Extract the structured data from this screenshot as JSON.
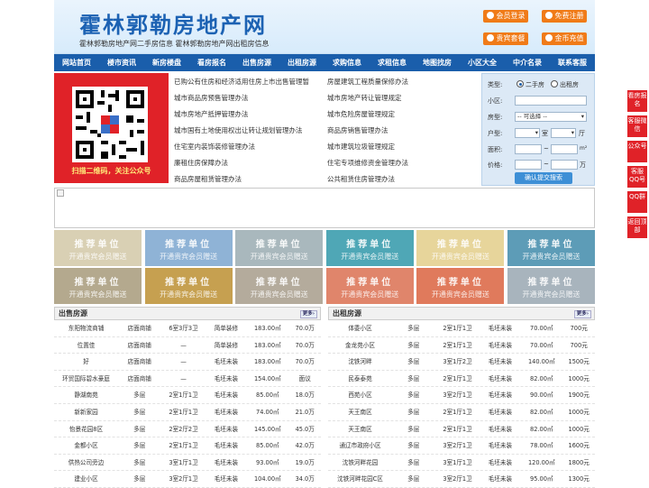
{
  "header": {
    "logo": "霍林郭勒房地产网",
    "slogan": "霍林郭勒房地产网二手房信息 霍林郭勒房地产网出租房信息",
    "buttons": [
      "会员登录",
      "免费注册",
      "贵宾套餐",
      "金币充值"
    ]
  },
  "nav": [
    "网站首页",
    "楼市资讯",
    "新房楼盘",
    "看房报名",
    "出售房源",
    "出租房源",
    "求购信息",
    "求租信息",
    "地图找房",
    "小区大全",
    "中介名录",
    "联系客服"
  ],
  "qr": {
    "caption": "扫描二维码，关注公众号"
  },
  "links": [
    "已购公有住房和经济适用住房上市出售管理暂",
    "房屋建筑工程质量保修办法",
    "城市商品房预售管理办法",
    "城市房地产转让管理规定",
    "城市房地产抵押管理办法",
    "城市危险房屋管理规定",
    "城市国有土地使用权出让转让规划管理办法",
    "商品房销售管理办法",
    "住宅室内装饰装修管理办法",
    "城市建筑垃圾管理规定",
    "廉租住房保障办法",
    "住宅专项维修资金管理办法",
    "商品房屋租赁管理办法",
    "公共租赁住房管理办法"
  ],
  "search": {
    "type_label": "类型:",
    "opt_sale": "二手房",
    "opt_rent": "出租房",
    "xiaoqu_label": "小区:",
    "fangxing_label": "房型:",
    "fangxing_value": "-- 可选择 --",
    "huxing_label": "户型:",
    "shi": "室",
    "ting": "厅",
    "area_label": "面积:",
    "price_label": "价格:",
    "tilde": "~",
    "sqm": "m²",
    "wan": "万",
    "submit": "确认提交搜索"
  },
  "ads": {
    "t1": "推荐单位",
    "t2": "开通贵宾会员赠送",
    "colors": [
      "#d9d0b4",
      "#8fb3d6",
      "#a9b8bd",
      "#4fa7b6",
      "#e7d59b",
      "#5d9cb7",
      "#b4a98e",
      "#c6a050",
      "#b4ab9c",
      "#e0856b",
      "#e07a5c",
      "#a8b4bd"
    ]
  },
  "sale": {
    "title": "出售房源",
    "more": "更多›",
    "rows": [
      [
        "东阳物流商铺",
        "店面商铺",
        "6室3厅3卫",
        "简单装修",
        "183.00㎡",
        "70.0万"
      ],
      [
        "位置佳",
        "店面商铺",
        "—",
        "简单装修",
        "183.00㎡",
        "70.0万"
      ],
      [
        "好",
        "店面商铺",
        "—",
        "毛坯未装",
        "183.00㎡",
        "70.0万"
      ],
      [
        "环贸国际碧水豪庭",
        "店面商铺",
        "—",
        "毛坯未装",
        "154.00㎡",
        "面议"
      ],
      [
        "静湖南苑",
        "多层",
        "2室1厅1卫",
        "毛坯未装",
        "85.00㎡",
        "18.0万"
      ],
      [
        "新新家园",
        "多层",
        "2室1厅1卫",
        "毛坯未装",
        "74.00㎡",
        "21.0万"
      ],
      [
        "怡景花园8区",
        "多层",
        "2室2厅2卫",
        "毛坯未装",
        "145.00㎡",
        "45.0万"
      ],
      [
        "金都小区",
        "多层",
        "2室1厅1卫",
        "毛坯未装",
        "85.00㎡",
        "42.0万"
      ],
      [
        "供热公司旁边",
        "多层",
        "3室1厅1卫",
        "毛坯未装",
        "93.00㎡",
        "19.0万"
      ],
      [
        "建业小区",
        "多层",
        "3室2厅1卫",
        "毛坯未装",
        "104.00㎡",
        "34.0万"
      ]
    ]
  },
  "rent": {
    "title": "出租房源",
    "more": "更多›",
    "rows": [
      [
        "体委小区",
        "多层",
        "2室1厅1卫",
        "毛坯未装",
        "70.00㎡",
        "700元"
      ],
      [
        "金龙苑小区",
        "多层",
        "2室1厅1卫",
        "毛坯未装",
        "70.00㎡",
        "700元"
      ],
      [
        "沈铁河畔",
        "多层",
        "3室1厅2卫",
        "毛坯未装",
        "140.00㎡",
        "1500元"
      ],
      [
        "民泰泰苑",
        "多层",
        "2室1厅1卫",
        "毛坯未装",
        "82.00㎡",
        "1000元"
      ],
      [
        "西苑小区",
        "多层",
        "3室2厅1卫",
        "毛坯未装",
        "90.00㎡",
        "1900元"
      ],
      [
        "天王南区",
        "多层",
        "2室1厅1卫",
        "毛坯未装",
        "82.00㎡",
        "1000元"
      ],
      [
        "天王南区",
        "多层",
        "2室1厅1卫",
        "毛坯未装",
        "82.00㎡",
        "1000元"
      ],
      [
        "通辽市政府小区",
        "多层",
        "3室2厅1卫",
        "毛坯未装",
        "78.00㎡",
        "1600元"
      ],
      [
        "沈铁河畔花园",
        "多层",
        "3室1厅1卫",
        "毛坯未装",
        "120.00㎡",
        "1800元"
      ],
      [
        "沈铁河畔花园C区",
        "多层",
        "3室2厅1卫",
        "毛坯未装",
        "95.00㎡",
        "1300元"
      ]
    ]
  },
  "sidebar": [
    "看房报名",
    "客服微信",
    "公众号",
    "客服QQ号",
    "QQ群",
    "返回顶部"
  ]
}
